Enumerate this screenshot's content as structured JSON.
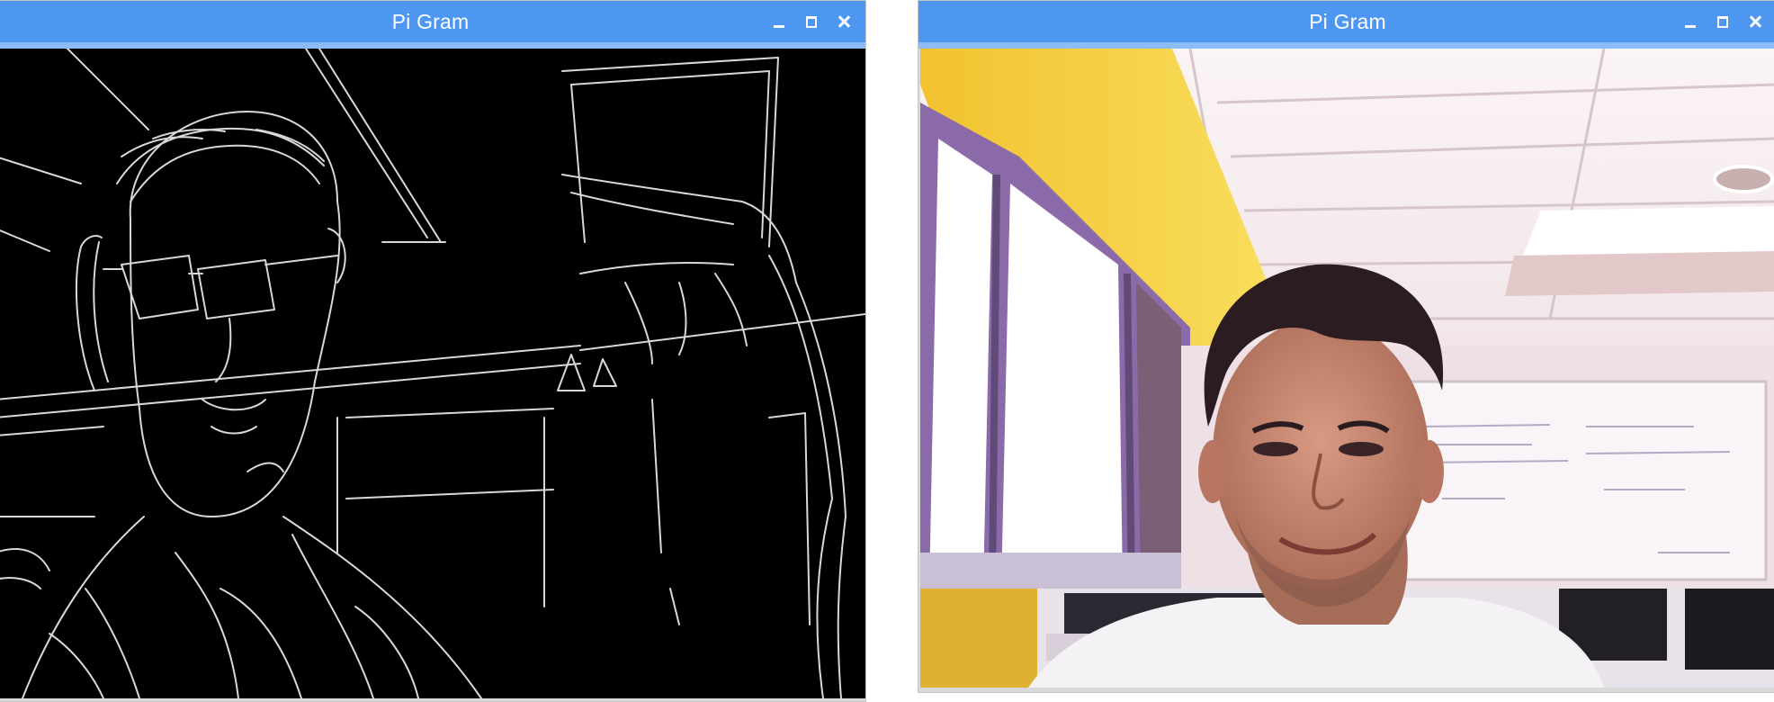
{
  "windows": [
    {
      "id": "edge-view",
      "title": "Pi Gram",
      "content": "canny-edge-camera-feed"
    },
    {
      "id": "color-view",
      "title": "Pi Gram",
      "content": "color-camera-feed"
    }
  ],
  "controls": {
    "minimize_icon": "minimize-icon",
    "maximize_icon": "maximize-icon",
    "close_icon": "close-icon"
  },
  "colors": {
    "titlebar": "#4d97f2",
    "titlebar_accent": "#8bbcf6",
    "edge_lines": "#d8d8d8",
    "edge_background": "#000000"
  }
}
